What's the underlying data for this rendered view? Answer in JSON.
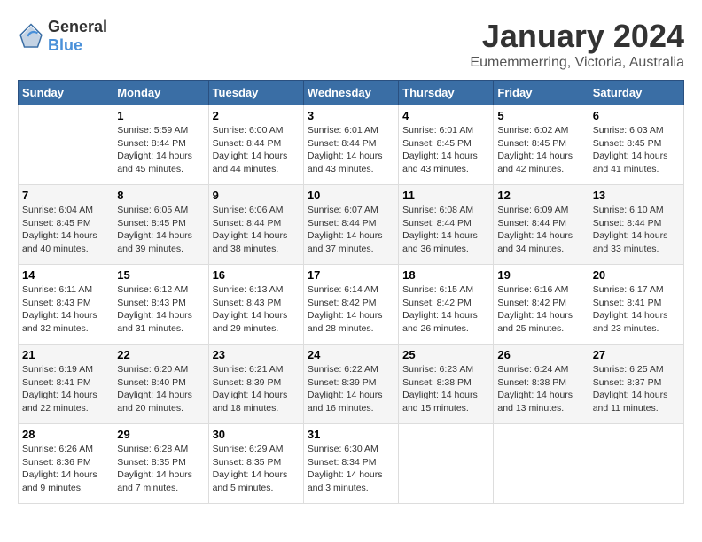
{
  "header": {
    "logo_general": "General",
    "logo_blue": "Blue",
    "title": "January 2024",
    "subtitle": "Eumemmerring, Victoria, Australia"
  },
  "calendar": {
    "days_of_week": [
      "Sunday",
      "Monday",
      "Tuesday",
      "Wednesday",
      "Thursday",
      "Friday",
      "Saturday"
    ],
    "weeks": [
      {
        "days": [
          {
            "number": "",
            "info": ""
          },
          {
            "number": "1",
            "info": "Sunrise: 5:59 AM\nSunset: 8:44 PM\nDaylight: 14 hours\nand 45 minutes."
          },
          {
            "number": "2",
            "info": "Sunrise: 6:00 AM\nSunset: 8:44 PM\nDaylight: 14 hours\nand 44 minutes."
          },
          {
            "number": "3",
            "info": "Sunrise: 6:01 AM\nSunset: 8:44 PM\nDaylight: 14 hours\nand 43 minutes."
          },
          {
            "number": "4",
            "info": "Sunrise: 6:01 AM\nSunset: 8:45 PM\nDaylight: 14 hours\nand 43 minutes."
          },
          {
            "number": "5",
            "info": "Sunrise: 6:02 AM\nSunset: 8:45 PM\nDaylight: 14 hours\nand 42 minutes."
          },
          {
            "number": "6",
            "info": "Sunrise: 6:03 AM\nSunset: 8:45 PM\nDaylight: 14 hours\nand 41 minutes."
          }
        ]
      },
      {
        "days": [
          {
            "number": "7",
            "info": "Sunrise: 6:04 AM\nSunset: 8:45 PM\nDaylight: 14 hours\nand 40 minutes."
          },
          {
            "number": "8",
            "info": "Sunrise: 6:05 AM\nSunset: 8:45 PM\nDaylight: 14 hours\nand 39 minutes."
          },
          {
            "number": "9",
            "info": "Sunrise: 6:06 AM\nSunset: 8:44 PM\nDaylight: 14 hours\nand 38 minutes."
          },
          {
            "number": "10",
            "info": "Sunrise: 6:07 AM\nSunset: 8:44 PM\nDaylight: 14 hours\nand 37 minutes."
          },
          {
            "number": "11",
            "info": "Sunrise: 6:08 AM\nSunset: 8:44 PM\nDaylight: 14 hours\nand 36 minutes."
          },
          {
            "number": "12",
            "info": "Sunrise: 6:09 AM\nSunset: 8:44 PM\nDaylight: 14 hours\nand 34 minutes."
          },
          {
            "number": "13",
            "info": "Sunrise: 6:10 AM\nSunset: 8:44 PM\nDaylight: 14 hours\nand 33 minutes."
          }
        ]
      },
      {
        "days": [
          {
            "number": "14",
            "info": "Sunrise: 6:11 AM\nSunset: 8:43 PM\nDaylight: 14 hours\nand 32 minutes."
          },
          {
            "number": "15",
            "info": "Sunrise: 6:12 AM\nSunset: 8:43 PM\nDaylight: 14 hours\nand 31 minutes."
          },
          {
            "number": "16",
            "info": "Sunrise: 6:13 AM\nSunset: 8:43 PM\nDaylight: 14 hours\nand 29 minutes."
          },
          {
            "number": "17",
            "info": "Sunrise: 6:14 AM\nSunset: 8:42 PM\nDaylight: 14 hours\nand 28 minutes."
          },
          {
            "number": "18",
            "info": "Sunrise: 6:15 AM\nSunset: 8:42 PM\nDaylight: 14 hours\nand 26 minutes."
          },
          {
            "number": "19",
            "info": "Sunrise: 6:16 AM\nSunset: 8:42 PM\nDaylight: 14 hours\nand 25 minutes."
          },
          {
            "number": "20",
            "info": "Sunrise: 6:17 AM\nSunset: 8:41 PM\nDaylight: 14 hours\nand 23 minutes."
          }
        ]
      },
      {
        "days": [
          {
            "number": "21",
            "info": "Sunrise: 6:19 AM\nSunset: 8:41 PM\nDaylight: 14 hours\nand 22 minutes."
          },
          {
            "number": "22",
            "info": "Sunrise: 6:20 AM\nSunset: 8:40 PM\nDaylight: 14 hours\nand 20 minutes."
          },
          {
            "number": "23",
            "info": "Sunrise: 6:21 AM\nSunset: 8:39 PM\nDaylight: 14 hours\nand 18 minutes."
          },
          {
            "number": "24",
            "info": "Sunrise: 6:22 AM\nSunset: 8:39 PM\nDaylight: 14 hours\nand 16 minutes."
          },
          {
            "number": "25",
            "info": "Sunrise: 6:23 AM\nSunset: 8:38 PM\nDaylight: 14 hours\nand 15 minutes."
          },
          {
            "number": "26",
            "info": "Sunrise: 6:24 AM\nSunset: 8:38 PM\nDaylight: 14 hours\nand 13 minutes."
          },
          {
            "number": "27",
            "info": "Sunrise: 6:25 AM\nSunset: 8:37 PM\nDaylight: 14 hours\nand 11 minutes."
          }
        ]
      },
      {
        "days": [
          {
            "number": "28",
            "info": "Sunrise: 6:26 AM\nSunset: 8:36 PM\nDaylight: 14 hours\nand 9 minutes."
          },
          {
            "number": "29",
            "info": "Sunrise: 6:28 AM\nSunset: 8:35 PM\nDaylight: 14 hours\nand 7 minutes."
          },
          {
            "number": "30",
            "info": "Sunrise: 6:29 AM\nSunset: 8:35 PM\nDaylight: 14 hours\nand 5 minutes."
          },
          {
            "number": "31",
            "info": "Sunrise: 6:30 AM\nSunset: 8:34 PM\nDaylight: 14 hours\nand 3 minutes."
          },
          {
            "number": "",
            "info": ""
          },
          {
            "number": "",
            "info": ""
          },
          {
            "number": "",
            "info": ""
          }
        ]
      }
    ]
  }
}
